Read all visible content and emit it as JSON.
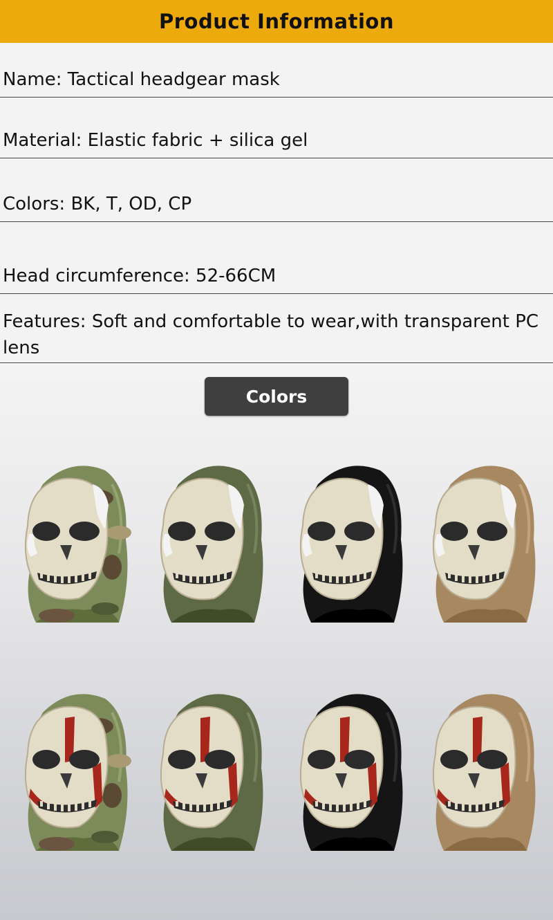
{
  "header": {
    "title": "Product Information"
  },
  "info": {
    "name": "Name: Tactical headgear mask",
    "material": "Material: Elastic fabric + silica gel",
    "colors": "Colors: BK, T, OD, CP",
    "head": "Head circumference: 52-66CM",
    "features": "Features: Soft and comfortable to wear,with transparent PC lens"
  },
  "gallery": {
    "button_label": "Colors",
    "masks": [
      {
        "hood": "camo",
        "hood_color": "#7d8a5a",
        "paint": "white"
      },
      {
        "hood": "olive",
        "hood_color": "#5e6a45",
        "paint": "white"
      },
      {
        "hood": "black",
        "hood_color": "#151515",
        "paint": "white"
      },
      {
        "hood": "tan",
        "hood_color": "#a78861",
        "paint": "white"
      },
      {
        "hood": "camo",
        "hood_color": "#7d8a5a",
        "paint": "red"
      },
      {
        "hood": "olive",
        "hood_color": "#5e6a45",
        "paint": "red"
      },
      {
        "hood": "black",
        "hood_color": "#151515",
        "paint": "red"
      },
      {
        "hood": "tan",
        "hood_color": "#a78861",
        "paint": "red"
      }
    ]
  }
}
